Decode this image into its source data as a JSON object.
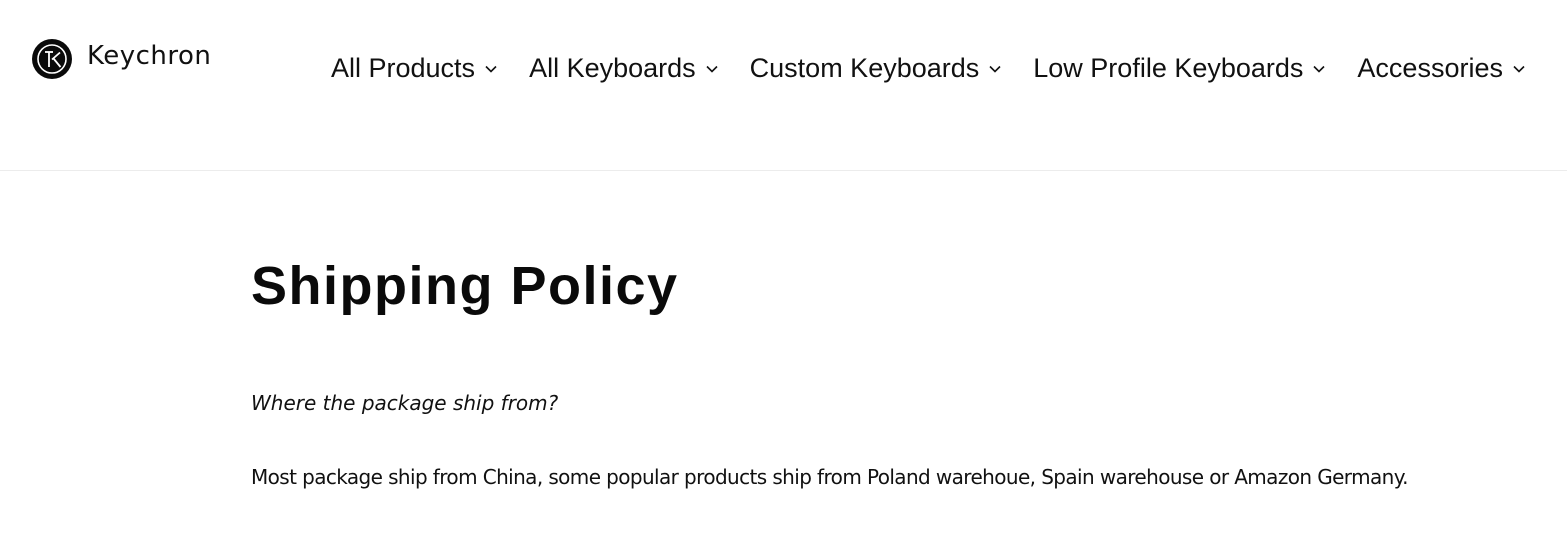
{
  "brand": {
    "name": "Keychron",
    "logo_icon": "keychron-k-logo"
  },
  "nav": {
    "items": [
      {
        "label": "All Products",
        "icon": "chevron-down"
      },
      {
        "label": "All Keyboards",
        "icon": "chevron-down"
      },
      {
        "label": "Custom Keyboards",
        "icon": "chevron-down"
      },
      {
        "label": "Low Profile Keyboards",
        "icon": "chevron-down"
      },
      {
        "label": "Accessories",
        "icon": "chevron-down"
      }
    ]
  },
  "page": {
    "title": "Shipping Policy",
    "sections": [
      {
        "question": "Where the package ship from?",
        "answer": "Most package ship from China, some popular products ship from Poland warehoue, Spain warehouse or Amazon Germany."
      }
    ]
  },
  "colors": {
    "text": "#111111",
    "background": "#ffffff",
    "divider": "#ececec"
  }
}
